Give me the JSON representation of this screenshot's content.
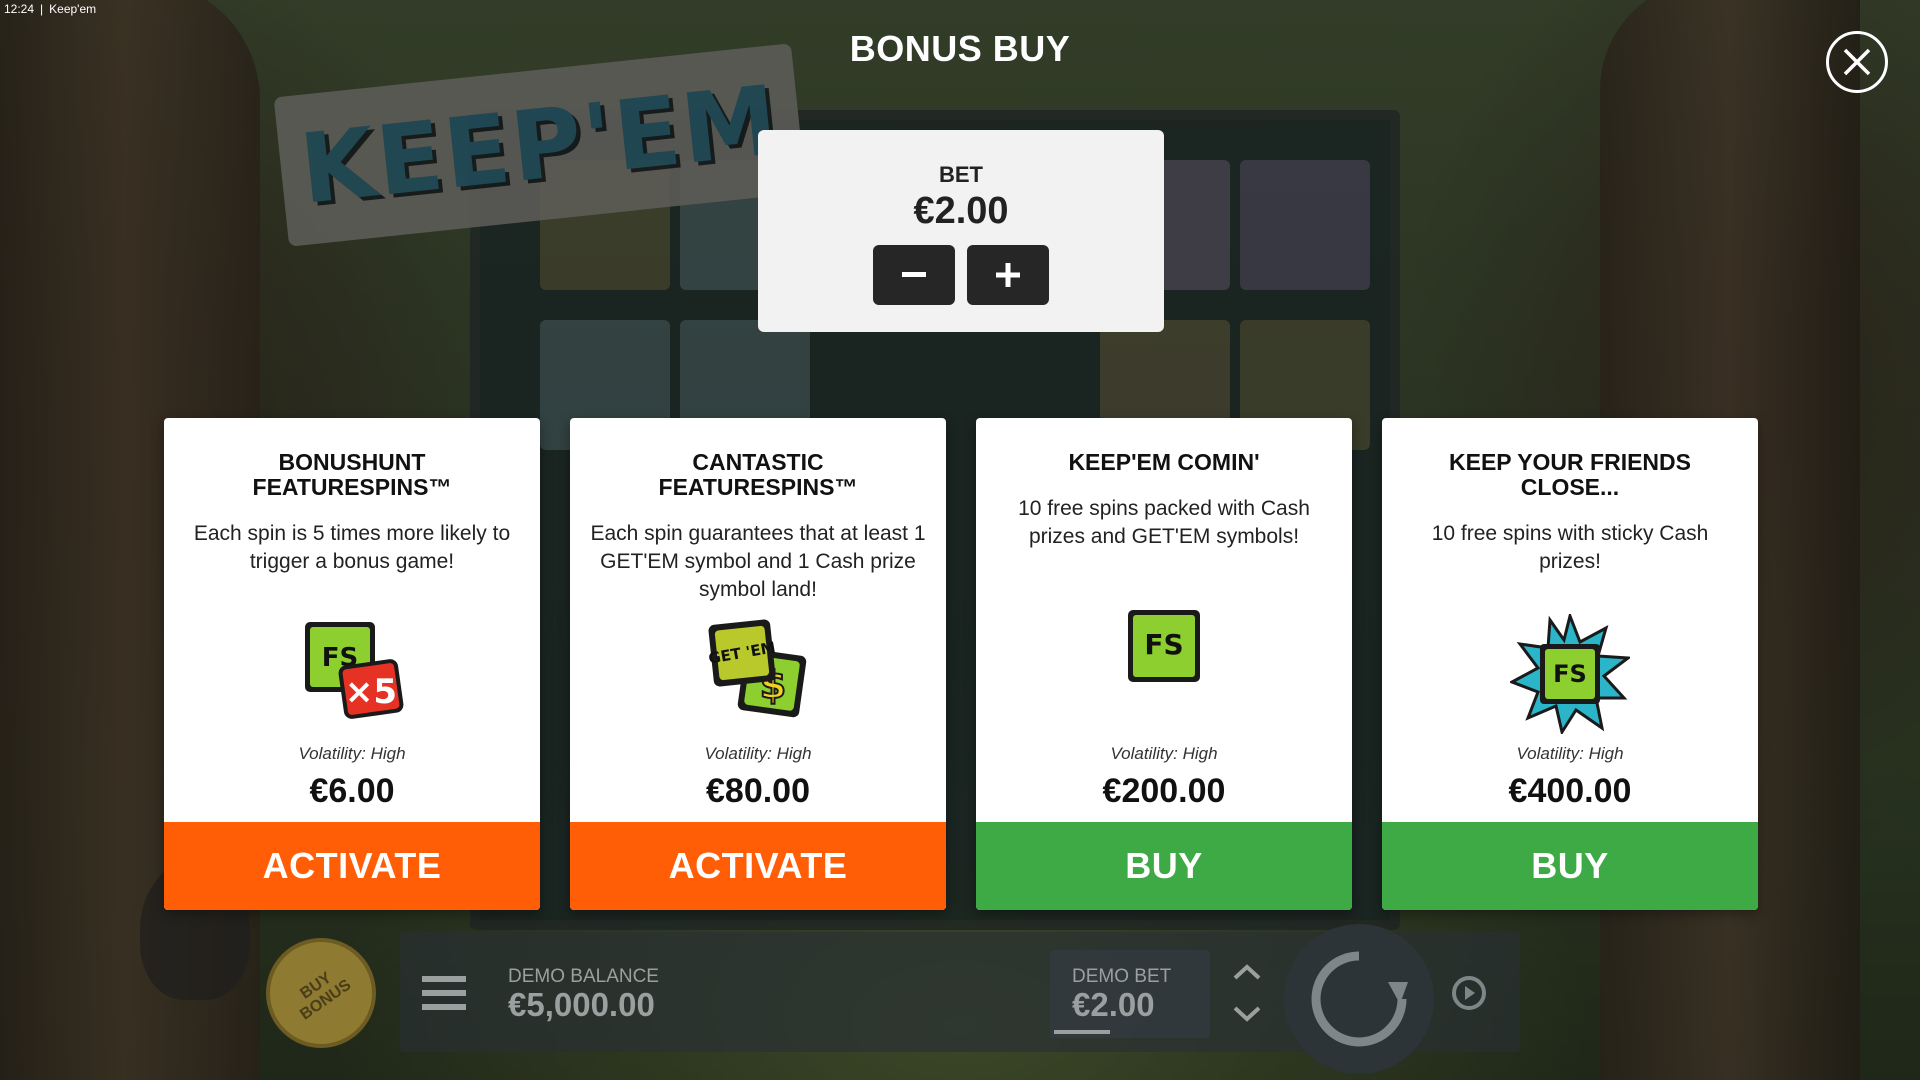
{
  "status_bar": {
    "time": "12:24",
    "separator": "|",
    "app": "Keep'em"
  },
  "background": {
    "logo_text": "KEEP'EM"
  },
  "header": {
    "title": "BONUS BUY",
    "close_icon": "close-icon"
  },
  "bet_panel": {
    "label": "BET",
    "value": "€2.00",
    "decrease_icon": "minus-icon",
    "increase_icon": "plus-icon"
  },
  "cards": [
    {
      "title": "BONUSHUNT\nFEATURESPINS™",
      "description": "Each spin is 5 times more likely to trigger a bonus game!",
      "icon": "fs-x5-icon",
      "icon_text": "FS",
      "icon_badge": "×5",
      "volatility": "Volatility: High",
      "price": "€6.00",
      "action": "ACTIVATE",
      "action_color": "#ff5e07"
    },
    {
      "title": "CANTASTIC\nFEATURESPINS™",
      "description": "Each spin guarantees that at least 1 GET'EM symbol and 1 Cash prize symbol land!",
      "icon": "getem-cash-icon",
      "icon_text": "GET 'EM",
      "icon_badge": "$",
      "volatility": "Volatility: High",
      "price": "€80.00",
      "action": "ACTIVATE",
      "action_color": "#ff5e07"
    },
    {
      "title": "KEEP'EM COMIN'",
      "description": "10 free spins packed with Cash prizes and GET'EM symbols!",
      "icon": "fs-icon",
      "icon_text": "FS",
      "volatility": "Volatility: High",
      "price": "€200.00",
      "action": "BUY",
      "action_color": "#3daa46"
    },
    {
      "title": "KEEP YOUR FRIENDS\nCLOSE...",
      "description": "10 free spins with sticky Cash prizes!",
      "icon": "fs-burst-icon",
      "icon_text": "FS",
      "volatility": "Volatility: High",
      "price": "€400.00",
      "action": "BUY",
      "action_color": "#3daa46"
    }
  ],
  "bottom_bar": {
    "buy_bonus_label": "BUY\nBONUS",
    "menu_icon": "menu-icon",
    "balance_label": "DEMO BALANCE",
    "balance_value": "€5,000.00",
    "bet_label": "DEMO BET",
    "bet_value": "€2.00",
    "bet_up_icon": "chevron-up-icon",
    "bet_down_icon": "chevron-down-icon",
    "spin_icon": "spin-icon",
    "autoplay_icon": "autoplay-icon"
  },
  "colors": {
    "activate": "#ff5e07",
    "buy": "#3daa46",
    "fs_green": "#8ccf2e",
    "badge_red": "#e53224",
    "burst_teal": "#2bb5c9"
  }
}
